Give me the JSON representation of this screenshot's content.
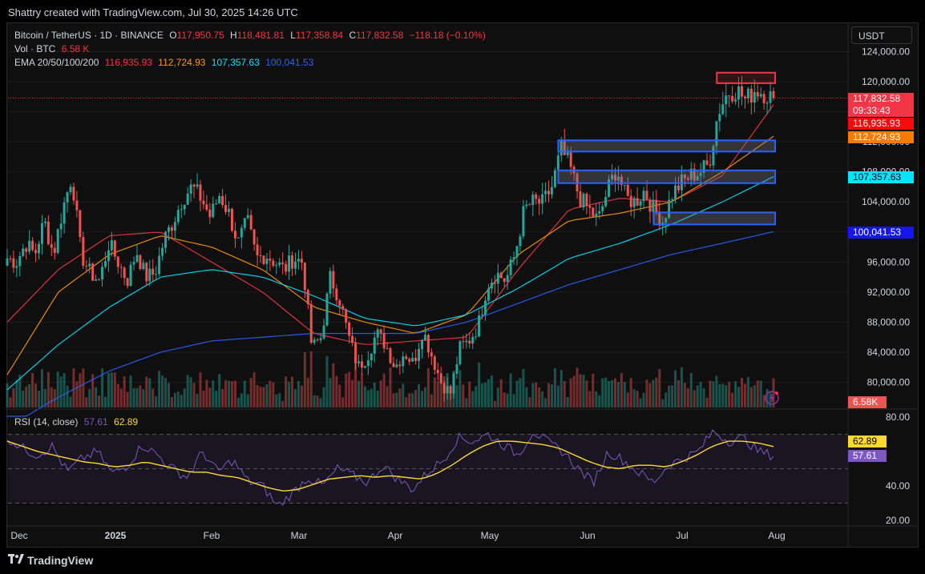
{
  "credit": "Shattry created with TradingView.com, Jul 30, 2025 14:26 UTC",
  "brand": "TradingView",
  "currency_button": "USDT",
  "legend": {
    "symbol": "Bitcoin / TetherUS · 1D · BINANCE",
    "o_label": "O",
    "o": "117,950.75",
    "h_label": "H",
    "h": "118,481.81",
    "l_label": "L",
    "l": "117,358.84",
    "c_label": "C",
    "c": "117,832.58",
    "change": "−118.18 (−0.10%)",
    "vol_label": "Vol · BTC",
    "vol": "6.58 K",
    "ema_label": "EMA 20/50/100/200",
    "ema20": "116,935.93",
    "ema50": "112,724.93",
    "ema100": "107,357.63",
    "ema200": "100,041.53"
  },
  "rsi_legend": {
    "label": "RSI (14, close)",
    "rsi": "57.61",
    "ma": "62.89"
  },
  "price_tags": {
    "last": "117,832.58",
    "countdown": "09:33:43",
    "ema20": "116,935.93",
    "ema50": "112,724.93",
    "ema100": "107,357.63",
    "ema200": "100,041.53",
    "volume": "6.58K",
    "rsi_ma": "62.89",
    "rsi": "57.61"
  },
  "colors": {
    "up": "#26a69a",
    "down": "#ef5350",
    "ema20": "#f23645",
    "ema50": "#ff9800",
    "ema100": "#00e5ff",
    "ema200": "#2962ff",
    "rsi": "#7e57c2",
    "rsi_ma": "#fdd835",
    "zone_blue": "#2962ff",
    "zone_red": "#f23645"
  },
  "chart_data": [
    {
      "type": "candlestick",
      "title": "Bitcoin / TetherUS · 1D · BINANCE",
      "x": [
        "Dec",
        "2025",
        "Feb",
        "Mar",
        "Apr",
        "May",
        "Jun",
        "Jul",
        "Aug"
      ],
      "ylim": [
        78000,
        126000
      ],
      "y_ticks": [
        "124,000.00",
        "120,000.00",
        "116,000.00",
        "112,000.00",
        "108,000.00",
        "104,000.00",
        "100,000.00",
        "96,000.00",
        "92,000.00",
        "88,000.00",
        "84,000.00",
        "80,000.00"
      ],
      "close_path": [
        96500,
        96000,
        98500,
        97000,
        101500,
        97000,
        103000,
        107500,
        97000,
        94500,
        93500,
        98500,
        96000,
        93500,
        97500,
        94000,
        94500,
        99000,
        101500,
        104500,
        106000,
        104500,
        102000,
        105000,
        102500,
        98500,
        101500,
        96500,
        97000,
        96000,
        95000,
        96500,
        96000,
        84500,
        86000,
        94000,
        91000,
        86000,
        82000,
        83500,
        86500,
        85000,
        82000,
        84000,
        82500,
        87000,
        83500,
        80000,
        78500,
        84500,
        85500,
        87500,
        93000,
        94500,
        93500,
        97000,
        103000,
        104000,
        103800,
        106000,
        111000,
        108500,
        104500,
        103000,
        101500,
        105500,
        108500,
        104500,
        104000,
        105500,
        103000,
        101500,
        105000,
        106500,
        107500,
        108000,
        109000,
        116000,
        118500,
        119000,
        117500,
        119000,
        118500,
        117832.58
      ],
      "series": [
        {
          "name": "EMA 20",
          "values": [
            88000,
            95000,
            99500,
            100000,
            96000,
            92000,
            86500,
            85000,
            85500,
            86000,
            95000,
            103000,
            104500,
            104000,
            107500,
            116935.93
          ]
        },
        {
          "name": "EMA 50",
          "values": [
            81000,
            92000,
            97000,
            99500,
            98000,
            95000,
            90000,
            88000,
            86500,
            89000,
            97000,
            101500,
            102500,
            104000,
            108000,
            112724.93
          ]
        },
        {
          "name": "EMA 100",
          "values": [
            79000,
            85000,
            90000,
            94000,
            95000,
            94000,
            91500,
            88500,
            87500,
            89000,
            92500,
            96500,
            98500,
            101000,
            104000,
            107357.63
          ]
        },
        {
          "name": "EMA 200",
          "values": [
            74000,
            78000,
            81500,
            84000,
            85500,
            86000,
            86500,
            86500,
            86500,
            88000,
            90500,
            93000,
            95000,
            97000,
            98500,
            100041.53
          ]
        }
      ],
      "zones": [
        {
          "color": "red",
          "ymin": 119800,
          "ymax": 121200,
          "from": "Jul 12",
          "to": "Jul 30"
        },
        {
          "color": "blue",
          "ymin": 110700,
          "ymax": 112200,
          "from": "May 22",
          "to": "Jul 30"
        },
        {
          "color": "blue",
          "ymin": 106500,
          "ymax": 108200,
          "from": "May 22",
          "to": "Jul 30"
        },
        {
          "color": "blue",
          "ymin": 101000,
          "ymax": 102600,
          "from": "Jun 22",
          "to": "Jul 30"
        }
      ]
    },
    {
      "type": "line",
      "title": "RSI (14, close)",
      "ylim": [
        20,
        80
      ],
      "y_ticks": [
        "80.00",
        "40.00",
        "20.00"
      ],
      "bands": [
        70,
        50,
        30
      ],
      "series": [
        {
          "name": "RSI",
          "values": [
            68,
            62,
            58,
            63,
            48,
            56,
            60,
            47,
            52,
            64,
            58,
            50,
            45,
            60,
            48,
            55,
            43,
            40,
            28,
            36,
            45,
            40,
            50,
            46,
            42,
            52,
            44,
            38,
            48,
            55,
            68,
            66,
            70,
            64,
            58,
            72,
            65,
            60,
            50,
            42,
            60,
            55,
            48,
            42,
            52,
            56,
            60,
            72,
            66,
            68,
            60,
            57.61
          ]
        },
        {
          "name": "RSI MA",
          "values": [
            66,
            63,
            60,
            58,
            56,
            54,
            53,
            51,
            52,
            54,
            52,
            50,
            48,
            48,
            46,
            45,
            42,
            39,
            37,
            38,
            41,
            44,
            45,
            46,
            45,
            46,
            45,
            44,
            47,
            52,
            58,
            63,
            66,
            66,
            65,
            64,
            62,
            58,
            54,
            51,
            50,
            52,
            52,
            51,
            54,
            58,
            63,
            66,
            66,
            65,
            62.89
          ]
        }
      ]
    }
  ]
}
